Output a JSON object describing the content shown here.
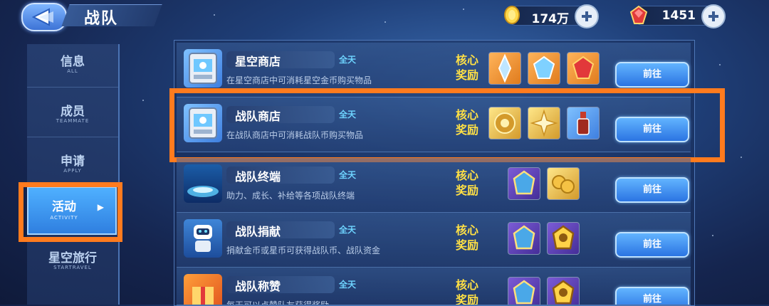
{
  "header": {
    "title": "战队",
    "currencies": [
      {
        "value": "174万",
        "icon": "gold-coin-icon"
      },
      {
        "value": "1451",
        "icon": "red-gem-icon"
      }
    ]
  },
  "sidebar": {
    "items": [
      {
        "label": "信息",
        "sub": "ALL"
      },
      {
        "label": "成员",
        "sub": "TEAMMATE"
      },
      {
        "label": "申请",
        "sub": "APPLY"
      },
      {
        "label": "活动",
        "sub": "ACTIVITY",
        "selected": true
      },
      {
        "label": "星空旅行",
        "sub": "STARTRAVEL"
      }
    ]
  },
  "reward_label": "核心奖励",
  "rows": [
    {
      "name": "星空商店",
      "time": "全天",
      "desc": "在星空商店中可消耗星空金币购买物品",
      "button": "前往"
    },
    {
      "name": "战队商店",
      "time": "全天",
      "desc": "在战队商店中可消耗战队币购买物品",
      "button": "前往"
    },
    {
      "name": "战队终端",
      "time": "全天",
      "desc": "助力、成长、补给等各项战队终端",
      "button": "前往"
    },
    {
      "name": "战队捐献",
      "time": "全天",
      "desc": "捐献金币或星币可获得战队币、战队资金",
      "button": "前往"
    },
    {
      "name": "战队称赞",
      "time": "全天",
      "desc": "每天可以点赞队友获得奖励",
      "button": "前往"
    }
  ],
  "colors": {
    "highlight": "#ff7b1e",
    "accent": "#ffe045",
    "time": "#6ed4ff"
  }
}
